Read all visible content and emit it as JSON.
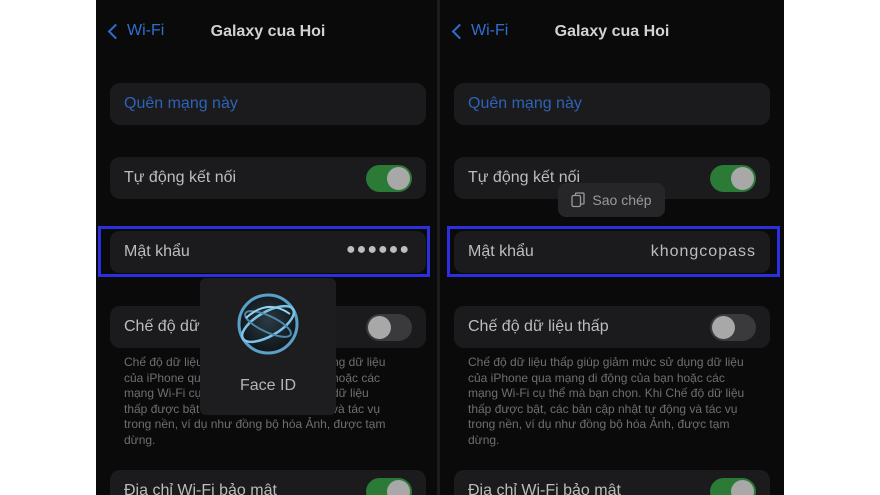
{
  "left": {
    "back_label": "Wi-Fi",
    "title": "Galaxy cua Hoi",
    "forget_label": "Quên mạng này",
    "auto_join_label": "Tự động kết nối",
    "password_label": "Mật khẩu",
    "password_value": "●●●●●●",
    "low_data_label": "Chế độ dữ li",
    "footer_lines": [
      "Chế độ dữ liệu",
      "của iPhone qu",
      "mạng Wi-Fi cụ",
      "thấp được bật",
      "trong nền, ví dụ như đồng bộ hóa Ảnh, được tạm",
      "dừng."
    ],
    "footer_lines_right": [
      "ng dữ liệu",
      "hoặc các",
      "dữ liệu",
      "và tác vụ"
    ],
    "private_label": "Địa chỉ Wi-Fi bảo mật",
    "faceid_label": "Face ID"
  },
  "right": {
    "back_label": "Wi-Fi",
    "title": "Galaxy cua Hoi",
    "forget_label": "Quên mạng này",
    "auto_join_label": "Tự động kết nối",
    "copy_label": "Sao chép",
    "password_label": "Mật khẩu",
    "password_value": "khongcopass",
    "low_data_label": "Chế độ dữ liệu thấp",
    "footer_lines": [
      "Chế độ dữ liệu thấp giúp giảm mức sử dụng dữ liệu",
      "của iPhone qua mạng di động của bạn hoặc các",
      "mạng Wi-Fi cụ thể mà bạn chọn. Khi Chế độ dữ liệu",
      "thấp được bật, các bản cập nhật tự động và tác vụ",
      "trong nền, ví dụ như đồng bộ hóa Ảnh, được tạm",
      "dừng."
    ],
    "private_label": "Địa chỉ Wi-Fi bảo mật"
  },
  "toggles": {
    "auto_join": true,
    "low_data": false,
    "private_address": true
  },
  "colors": {
    "link_blue": "#2f6fd0",
    "toggle_on": "#2b7a36",
    "highlight_border": "#2b2fe0"
  },
  "icons": [
    "back-chevron-icon",
    "face-id-icon",
    "copy-icon"
  ]
}
